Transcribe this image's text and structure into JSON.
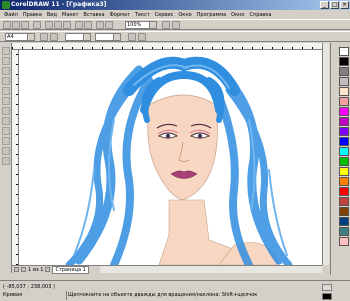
{
  "window": {
    "title": "CorelDRAW 11 - [Графика3]",
    "controls": [
      "_",
      "□",
      "×"
    ]
  },
  "menu": [
    "Файл",
    "Правка",
    "Вид",
    "Макет",
    "Вставка",
    "Формат",
    "Текст",
    "Сервис",
    "Окно",
    "Программа",
    "Окно",
    "Справка"
  ],
  "toolbar": {
    "zoom_value": "100%",
    "page_size": "A4"
  },
  "page_tabs": {
    "page_label": "1 из 1",
    "tab": "Страница 1"
  },
  "status": {
    "position": "( -85,037 ; 238,003 )",
    "tool": "Кривая",
    "message": "Щелчокните на объекте дважды для вращения/наклона; Shift+щелчок"
  },
  "palette_colors": [
    "#ffffff",
    "#000000",
    "#808080",
    "#c0c0c0",
    "#ffe4c8",
    "#f0a0a0",
    "#ff00ff",
    "#c000c0",
    "#8000ff",
    "#0000ff",
    "#00ffff",
    "#00c000",
    "#ffff00",
    "#ff8000",
    "#ff0000",
    "#c04040",
    "#804000",
    "#004080",
    "#408080",
    "#ffc0c0"
  ],
  "colors": {
    "hair": "#2f8ee0",
    "hair_light": "#6fb6f0",
    "skin": "#f7d7c2",
    "lips": "#a8407a"
  },
  "icons": [
    "corel-app-icon",
    "pick-tool-icon",
    "shape-tool-icon",
    "zoom-tool-icon",
    "freehand-tool-icon",
    "rectangle-tool-icon",
    "ellipse-tool-icon",
    "polygon-tool-icon",
    "text-tool-icon",
    "interactive-fill-icon",
    "eyedropper-icon",
    "outline-tool-icon",
    "fill-tool-icon"
  ]
}
